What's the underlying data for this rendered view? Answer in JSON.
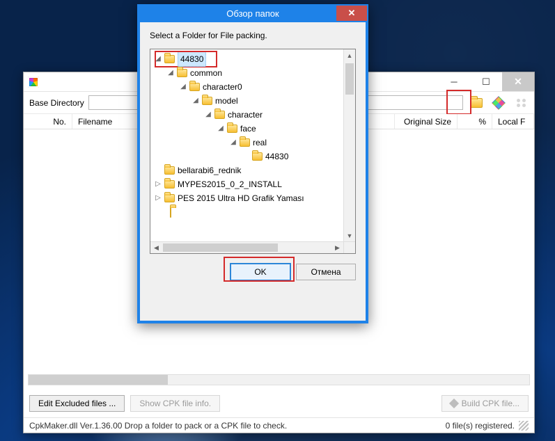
{
  "main": {
    "base_dir_label": "Base Directory",
    "base_dir_value": "",
    "columns": {
      "no": "No.",
      "filename": "Filename",
      "original_size": "Original Size",
      "percent": "%",
      "local": "Local F"
    },
    "buttons": {
      "edit_excluded": "Edit Excluded files ...",
      "show_info": "Show CPK file info.",
      "build": "Build CPK file..."
    },
    "status_left": "CpkMaker.dll Ver.1.36.00  Drop a folder to pack or a CPK file to check.",
    "status_right": "0 file(s) registered."
  },
  "dialog": {
    "title": "Обзор папок",
    "instruction": "Select a Folder for File packing.",
    "ok": "OK",
    "cancel": "Отмена",
    "tree": {
      "root": "44830",
      "n1": "common",
      "n2": "character0",
      "n3": "model",
      "n4": "character",
      "n5": "face",
      "n6": "real",
      "n7": "44830",
      "s1": "bellarabi6_rednik",
      "s2": "MYPES2015_0_2_INSTALL",
      "s3": "PES 2015 Ultra HD Grafik Yaması"
    }
  }
}
